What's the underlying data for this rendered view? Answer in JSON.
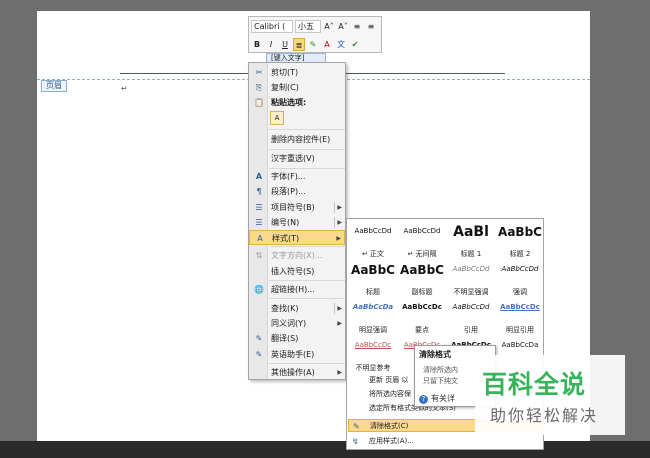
{
  "page": {
    "header_tag": "页眉",
    "para_mark": "↵",
    "content_control_text": "[键入文字]"
  },
  "mini_toolbar": {
    "font_name": "Calibri (",
    "font_size": "小五",
    "buttons_row1": [
      "A˄",
      "A˅",
      "≡",
      "≡"
    ],
    "buttons_row2": [
      "B",
      "I",
      "U",
      "≣",
      "✎",
      "A",
      "文",
      "✔"
    ]
  },
  "context_menu": {
    "items": [
      {
        "icon": "✂",
        "label": "剪切(T)"
      },
      {
        "icon": "⎘",
        "label": "复制(C)"
      },
      {
        "icon": "📋",
        "label": "粘贴选项:"
      },
      {
        "icon": "",
        "label": "删除内容控件(E)"
      },
      {
        "icon": "",
        "label": "汉字重选(V)"
      },
      {
        "icon": "A",
        "label": "字体(F)..."
      },
      {
        "icon": "¶",
        "label": "段落(P)..."
      },
      {
        "icon": "☰",
        "label": "项目符号(B)"
      },
      {
        "icon": "☰",
        "label": "编号(N)"
      },
      {
        "icon": "A",
        "label": "样式(T)"
      },
      {
        "icon": "⇅",
        "label": "文字方向(X)..."
      },
      {
        "icon": "",
        "label": "插入符号(S)"
      },
      {
        "icon": "🌐",
        "label": "超链接(H)..."
      },
      {
        "icon": "",
        "label": "查找(K)"
      },
      {
        "icon": "",
        "label": "同义词(Y)"
      },
      {
        "icon": "✎",
        "label": "翻译(S)"
      },
      {
        "icon": "✎",
        "label": "英语助手(E)"
      },
      {
        "icon": "",
        "label": "其他操作(A)"
      }
    ]
  },
  "styles_gallery": {
    "cells": [
      {
        "preview": "AaBbCcDd",
        "name": "↵ 正文"
      },
      {
        "preview": "AaBbCcDd",
        "name": "↵ 无间隔"
      },
      {
        "preview": "AaBl",
        "name": "标题 1"
      },
      {
        "preview": "AaBbC",
        "name": "标题 2"
      },
      {
        "preview": "AaBbC",
        "name": "标题"
      },
      {
        "preview": "AaBbC",
        "name": "副标题"
      },
      {
        "preview": "AaBbCcDd",
        "name": "不明显强调"
      },
      {
        "preview": "AaBbCcDd",
        "name": "强调"
      },
      {
        "preview": "AaBbCcDa",
        "name": "明显强调"
      },
      {
        "preview": "AaBbCcDc",
        "name": "要点"
      },
      {
        "preview": "AaBbCcDd",
        "name": "引用"
      },
      {
        "preview": "AaBbCcDc",
        "name": "明显引用"
      },
      {
        "preview": "AaBbCcDc",
        "name": "不明显参考"
      },
      {
        "preview": "AaBbCcDc",
        "name": "明"
      },
      {
        "preview": "AaBbCcDc",
        "name": ""
      },
      {
        "preview": "AaBbCcDa",
        "name": ""
      }
    ],
    "list": [
      {
        "icon": "",
        "label": "更新 页眉 以"
      },
      {
        "icon": "",
        "label": "将所选内容保"
      },
      {
        "icon": "",
        "label": "选定所有格式类似的文本(S)"
      },
      {
        "icon": "✎",
        "label": "清除格式(C)"
      },
      {
        "icon": "↯",
        "label": "应用样式(A)..."
      }
    ]
  },
  "tooltip": {
    "title": "清除格式",
    "line1": "清除所选内",
    "line2": "只留下纯文",
    "more": "有关详"
  },
  "watermark": {
    "brand": "百科全说",
    "slogan": "助你轻松解决"
  },
  "colors": {
    "highlight": "#f9d98c",
    "watermark_green": "#38b35a"
  }
}
